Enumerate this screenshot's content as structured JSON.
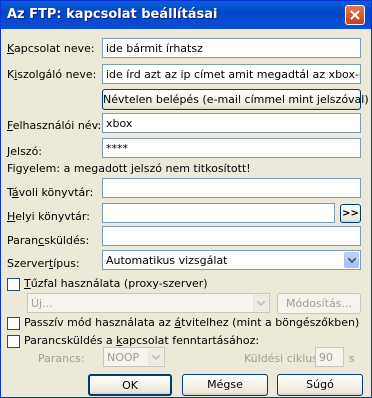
{
  "window": {
    "title": "Az FTP: kapcsolat beállításai"
  },
  "fields": {
    "connection_name": {
      "label_u": "K",
      "label_rest": "apcsolat neve:",
      "value": "ide bármit írhatsz"
    },
    "server_name": {
      "label_pre": "K",
      "label_u": "i",
      "label_rest": "szolgáló neve:",
      "value": "ide írd azt az ip címet amit megadtál az xbox-nak"
    },
    "anonymous_button": "Névtelen belépés (e-mail címmel mint jelszóval)",
    "username": {
      "label_u": "F",
      "label_rest": "elhasználói név:",
      "value": "xbox"
    },
    "password": {
      "label_u": "J",
      "label_rest": "elszó:",
      "value": "****"
    },
    "warning": "Figyelem: a megadott jelszó nem titkosított!",
    "remote_dir": {
      "label_pre": "T",
      "label_u": "á",
      "label_rest": "voli könyvtár:",
      "value": ""
    },
    "local_dir": {
      "label_u": "H",
      "label_rest": "elyi könyvtár:",
      "value": "",
      "browse_label": ">>"
    },
    "commands": {
      "label_pre": "Paran",
      "label_u": "c",
      "label_rest": "sküldés:",
      "value": ""
    },
    "server_type": {
      "label_pre": "Szerver",
      "label_u": "t",
      "label_rest": "ípus:",
      "value": "Automatikus vizsgálat"
    }
  },
  "firewall": {
    "checkbox_pre": "",
    "checkbox_u": "T",
    "checkbox_rest": "űzfal használata (proxy-szerver)",
    "checked": false,
    "proxy_value": "Új...",
    "modify_label": "Módosítás..."
  },
  "passive": {
    "label_pre": "Passzív mód használata az ",
    "label_u": "á",
    "label_rest": "tvitelhez (mint a böngészőkben)",
    "checked": false
  },
  "keepalive": {
    "label_pre": "Parancsküldés a ",
    "label_u": "k",
    "label_rest": "apcsolat fenntartásához:",
    "checked": false,
    "command_label": "Parancs:",
    "command_value": "NOOP",
    "cycle_label": "Küldési ciklus:",
    "cycle_value": "90",
    "cycle_unit": "s"
  },
  "buttons": {
    "ok": "OK",
    "cancel": "Mégse",
    "help": "Súgó"
  }
}
